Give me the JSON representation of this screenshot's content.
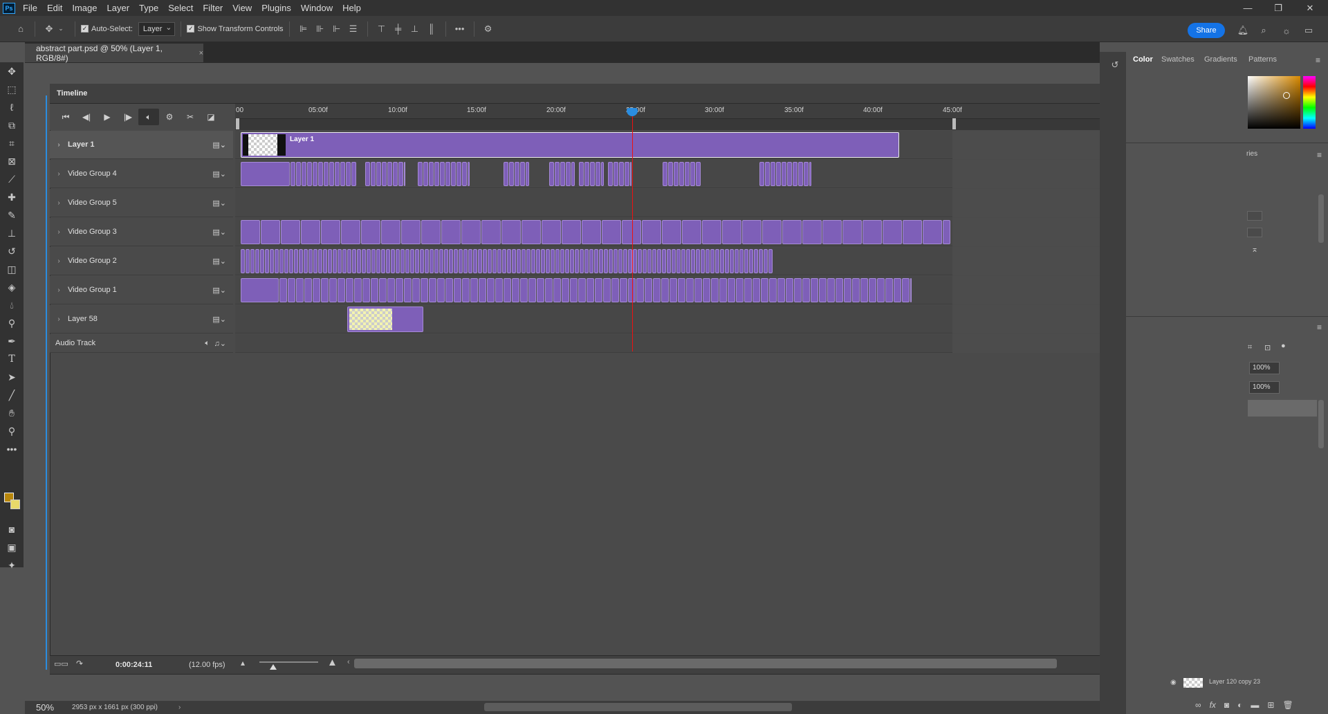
{
  "app": {
    "logo": "Ps"
  },
  "menu": [
    "File",
    "Edit",
    "Image",
    "Layer",
    "Type",
    "Select",
    "Filter",
    "View",
    "Plugins",
    "Window",
    "Help"
  ],
  "window_controls": {
    "minimize": "—",
    "restore": "❐",
    "close": "✕"
  },
  "options": {
    "auto_select_label": "Auto-Select:",
    "auto_select_value": "Layer",
    "show_transform_label": "Show Transform Controls",
    "share_label": "Share"
  },
  "document": {
    "tab_title": "abstract part.psd @ 50% (Layer 1, RGB/8#)",
    "close": "×"
  },
  "timeline": {
    "title": "Timeline",
    "ruler": [
      "00",
      "05:00f",
      "10:00f",
      "15:00f",
      "20:00f",
      "25:00f",
      "30:00f",
      "35:00f",
      "40:00f",
      "45:00f"
    ],
    "playhead_time": "25:00f",
    "tracks": [
      {
        "name": "Layer 1",
        "selected": true
      },
      {
        "name": "Video Group 4"
      },
      {
        "name": "Video Group 5"
      },
      {
        "name": "Video Group 3"
      },
      {
        "name": "Video Group 2"
      },
      {
        "name": "Video Group 1"
      },
      {
        "name": "Layer 58"
      }
    ],
    "audio_track": "Audio Track",
    "clip_label": "Layer 1",
    "current_time": "0:00:24:11",
    "fps": "(12.00 fps)"
  },
  "status": {
    "zoom": "50%",
    "doc_size": "2953 px x 1661 px (300 ppi)"
  },
  "right_panels": {
    "tabs": [
      "Color",
      "Swatches",
      "Gradients",
      "Patterns"
    ],
    "properties_partial": "ries",
    "opacity": "100%",
    "fill": "100%",
    "layer_row_partial": "Layer 120 copy 23"
  }
}
